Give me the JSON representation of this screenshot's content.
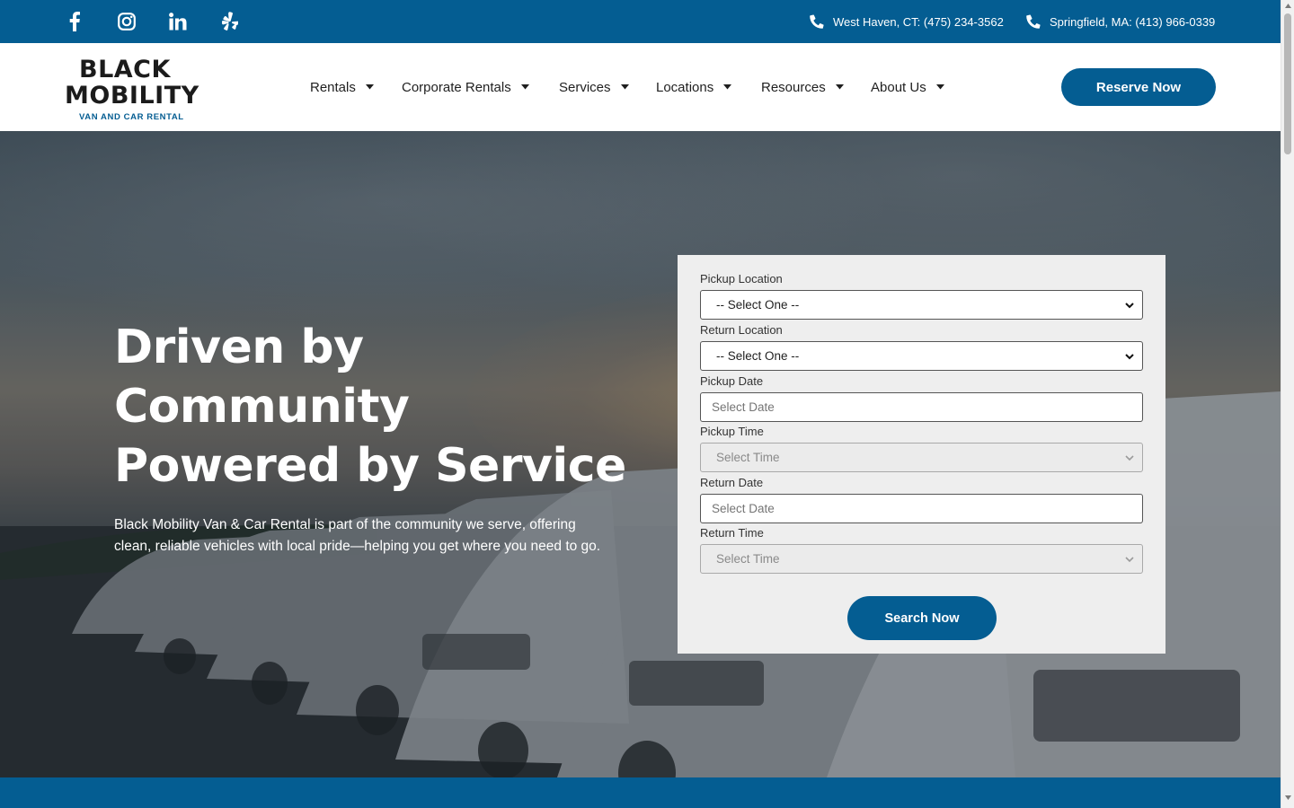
{
  "topbar": {
    "social": [
      {
        "icon": "facebook-icon"
      },
      {
        "icon": "instagram-icon"
      },
      {
        "icon": "linkedin-icon"
      },
      {
        "icon": "yelp-icon"
      }
    ],
    "phones": [
      {
        "icon": "phone-icon",
        "label": "West Haven, CT: (475) 234-3562"
      },
      {
        "icon": "phone-icon",
        "label": "Springfield, MA: (413) 966-0339"
      }
    ]
  },
  "header": {
    "logo": {
      "line1": "BLACK",
      "line2": "MOBILITY",
      "sub": "VAN AND CAR RENTAL"
    },
    "nav": [
      {
        "label": "Rentals"
      },
      {
        "label": "Corporate Rentals"
      },
      {
        "label": "Services"
      },
      {
        "label": "Locations"
      },
      {
        "label": "Resources"
      },
      {
        "label": "About Us"
      }
    ],
    "reserve_label": "Reserve Now"
  },
  "hero": {
    "headline": [
      "Driven by",
      "Community",
      "Powered by Service"
    ],
    "text": "Black Mobility Van & Car Rental is part of the community we serve, offering clean, reliable vehicles with local pride—helping you get where you need to go."
  },
  "form": {
    "pickup_location": {
      "label": "Pickup Location",
      "value": "-- Select One --"
    },
    "return_location": {
      "label": "Return Location",
      "value": "-- Select One --"
    },
    "pickup_date": {
      "label": "Pickup Date",
      "placeholder": "Select Date"
    },
    "pickup_time": {
      "label": "Pickup Time",
      "value": "Select Time"
    },
    "return_date": {
      "label": "Return Date",
      "placeholder": "Select Date"
    },
    "return_time": {
      "label": "Return Time",
      "value": "Select Time"
    },
    "search_label": "Search Now"
  },
  "colors": {
    "brand": "#045d92",
    "form_bg": "#eeeeee",
    "text_dark": "#1f1f1f"
  }
}
